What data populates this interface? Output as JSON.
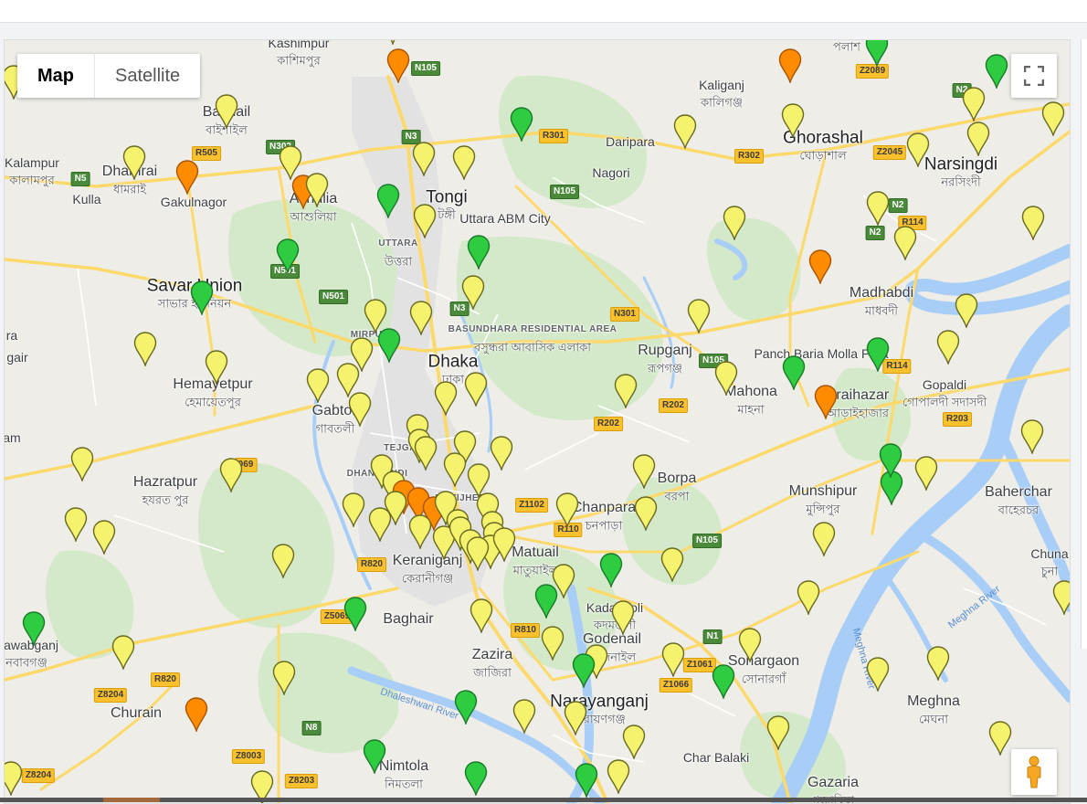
{
  "map_type": {
    "options": [
      "Map",
      "Satellite"
    ],
    "selected": "Map"
  },
  "controls": {
    "fullscreen_icon": "fullscreen-icon",
    "street_view_icon": "pegman-icon"
  },
  "marker_colors": {
    "green": "#2ecc40",
    "yellow": "#f5f26e",
    "orange": "#ff8c00"
  },
  "places": [
    {
      "id": "kashimpur",
      "en": "Kashimpur",
      "bn": "কাশিমপুর"
    },
    {
      "id": "kaliganj",
      "en": "Kaliganj",
      "bn": "কালিগঞ্জ"
    },
    {
      "id": "palash",
      "en": "",
      "bn": "পলাশ"
    },
    {
      "id": "bashail",
      "en": "Bashail",
      "bn": "বাইশাইল"
    },
    {
      "id": "kalampur",
      "en": "Kalampur",
      "bn": "কালামপুর"
    },
    {
      "id": "dhamrai",
      "en": "Dhamrai",
      "bn": "ধামরাই"
    },
    {
      "id": "kulla",
      "en": "Kulla",
      "bn": ""
    },
    {
      "id": "gakulnagor",
      "en": "Gakulnagor",
      "bn": ""
    },
    {
      "id": "ashulia",
      "en": "Ashulia",
      "bn": "আশুলিয়া"
    },
    {
      "id": "tongi",
      "en": "Tongi",
      "bn": "টঙ্গী"
    },
    {
      "id": "uttara_abm",
      "en": "Uttara ABM City",
      "bn": ""
    },
    {
      "id": "uttara",
      "en": "UTTARA",
      "bn": "উত্তরা"
    },
    {
      "id": "daripara",
      "en": "Daripara",
      "bn": ""
    },
    {
      "id": "nagori",
      "en": "Nagori",
      "bn": ""
    },
    {
      "id": "ghorashal",
      "en": "Ghorashal",
      "bn": "ঘোড়াশাল"
    },
    {
      "id": "narsingdi",
      "en": "Narsingdi",
      "bn": "নরসিংদী"
    },
    {
      "id": "savar",
      "en": "Savar Union",
      "bn": "সাভার ইউনিয়ন"
    },
    {
      "id": "mirpur",
      "en": "MIRPUR",
      "bn": ""
    },
    {
      "id": "bashundhara",
      "en": "BASUNDHARA RESIDENTIAL AREA",
      "bn": "বসুন্ধরা আবাসিক এলাকা"
    },
    {
      "id": "dhaka",
      "en": "Dhaka",
      "bn": "ঢাকা"
    },
    {
      "id": "madhabdi",
      "en": "Madhabdi",
      "bn": "মাধবদী"
    },
    {
      "id": "rupganj",
      "en": "Rupganj",
      "bn": "রূপগঞ্জ"
    },
    {
      "id": "panchbaria",
      "en": "Panch Baria Molla Para",
      "bn": ""
    },
    {
      "id": "hemayetpur",
      "en": "Hemayetpur",
      "bn": "হেমায়েতপুর"
    },
    {
      "id": "gabtoli",
      "en": "Gabtoli",
      "bn": "গাবতলী"
    },
    {
      "id": "mahona",
      "en": "Mahona",
      "bn": "মাহনা"
    },
    {
      "id": "araihazar",
      "en": "Araihazar",
      "bn": "আড়াইহাজার"
    },
    {
      "id": "gopaldi",
      "en": "Gopaldi",
      "bn": "গোপালদী সদাসদী"
    },
    {
      "id": "hazratpur",
      "en": "Hazratpur",
      "bn": "হযরত পুর"
    },
    {
      "id": "tejgaon",
      "en": "TEJGAON",
      "bn": ""
    },
    {
      "id": "dhanmondi",
      "en": "DHANMONDI",
      "bn": ""
    },
    {
      "id": "motijheel",
      "en": "MOTIJHEEL",
      "bn": ""
    },
    {
      "id": "borpa",
      "en": "Borpa",
      "bn": "বরপা"
    },
    {
      "id": "munshipur",
      "en": "Munshipur",
      "bn": "মুন্সিপুর"
    },
    {
      "id": "baherchar",
      "en": "Baherchar",
      "bn": "বাহেরচর"
    },
    {
      "id": "chanpara",
      "en": "Chanpara",
      "bn": "চনপাড়া"
    },
    {
      "id": "keraniganj",
      "en": "Keraniganj",
      "bn": "কেরানীগঞ্জ"
    },
    {
      "id": "matuail",
      "en": "Matuail",
      "bn": "মাতুয়াইল"
    },
    {
      "id": "chuna",
      "en": "Chuna",
      "bn": "চুনা"
    },
    {
      "id": "kadamtoli",
      "en": "Kadamtoli",
      "bn": "কদমতলী"
    },
    {
      "id": "baghair",
      "en": "Baghair",
      "bn": ""
    },
    {
      "id": "godenail",
      "en": "Godenail",
      "bn": "গোদনাইল"
    },
    {
      "id": "nawabganj",
      "en": "Nawabganj",
      "bn": "নবাবগঞ্জ"
    },
    {
      "id": "zazira",
      "en": "Zazira",
      "bn": "জাজিরা"
    },
    {
      "id": "sonargaon",
      "en": "Sonargaon",
      "bn": "সোনারগাঁ"
    },
    {
      "id": "narayanganj",
      "en": "Narayanganj",
      "bn": "নারায়ণগঞ্জ"
    },
    {
      "id": "meghna",
      "en": "Meghna",
      "bn": "মেঘনা"
    },
    {
      "id": "churain",
      "en": "Churain",
      "bn": ""
    },
    {
      "id": "nimtola",
      "en": "Nimtola",
      "bn": "নিমতলা"
    },
    {
      "id": "charbalaki",
      "en": "Char Balaki",
      "bn": ""
    },
    {
      "id": "gazaria",
      "en": "Gazaria",
      "bn": "গজারিয়া"
    },
    {
      "id": "ra",
      "en": "ra",
      "bn": ""
    },
    {
      "id": "gair",
      "en": "gair",
      "bn": ""
    },
    {
      "id": "am",
      "en": "am",
      "bn": ""
    }
  ],
  "rivers": [
    "Dhaleshwari River",
    "Meghna River",
    "Meghna River"
  ],
  "road_shields": [
    {
      "label": "N105",
      "style": "g"
    },
    {
      "label": "R505",
      "style": "y"
    },
    {
      "label": "N302",
      "style": "g"
    },
    {
      "label": "N5",
      "style": "g"
    },
    {
      "label": "N3",
      "style": "g"
    },
    {
      "label": "R301",
      "style": "y"
    },
    {
      "label": "N105",
      "style": "g"
    },
    {
      "label": "R302",
      "style": "y"
    },
    {
      "label": "Z2045",
      "style": "y"
    },
    {
      "label": "N2",
      "style": "g"
    },
    {
      "label": "N2",
      "style": "g"
    },
    {
      "label": "R114",
      "style": "y"
    },
    {
      "label": "N2",
      "style": "g"
    },
    {
      "label": "Z2089",
      "style": "y"
    },
    {
      "label": "N501",
      "style": "g"
    },
    {
      "label": "N501",
      "style": "g"
    },
    {
      "label": "N3",
      "style": "g"
    },
    {
      "label": "N301",
      "style": "y"
    },
    {
      "label": "N105",
      "style": "g"
    },
    {
      "label": "R114",
      "style": "y"
    },
    {
      "label": "R202",
      "style": "y"
    },
    {
      "label": "R202",
      "style": "y"
    },
    {
      "label": "R203",
      "style": "y"
    },
    {
      "label": "069",
      "style": "y"
    },
    {
      "label": "Z1102",
      "style": "y"
    },
    {
      "label": "R110",
      "style": "y"
    },
    {
      "label": "N105",
      "style": "g"
    },
    {
      "label": "R820",
      "style": "y"
    },
    {
      "label": "Z5069",
      "style": "y"
    },
    {
      "label": "R810",
      "style": "y"
    },
    {
      "label": "N1",
      "style": "g"
    },
    {
      "label": "Z1061",
      "style": "y"
    },
    {
      "label": "Z1066",
      "style": "y"
    },
    {
      "label": "R820",
      "style": "y"
    },
    {
      "label": "Z8204",
      "style": "y"
    },
    {
      "label": "N8",
      "style": "g"
    },
    {
      "label": "Z8003",
      "style": "y"
    },
    {
      "label": "Z8203",
      "style": "y"
    },
    {
      "label": "Z8204",
      "style": "y"
    }
  ],
  "markers": [
    {
      "color": "yellow"
    },
    {
      "color": "orange"
    },
    {
      "color": "yellow"
    },
    {
      "color": "orange"
    },
    {
      "color": "green"
    },
    {
      "color": "green"
    },
    {
      "color": "yellow"
    },
    {
      "color": "yellow"
    },
    {
      "color": "yellow"
    },
    {
      "color": "orange"
    },
    {
      "color": "yellow"
    },
    {
      "color": "yellow"
    },
    {
      "color": "yellow"
    },
    {
      "color": "yellow"
    },
    {
      "color": "green"
    },
    {
      "color": "yellow"
    },
    {
      "color": "yellow"
    },
    {
      "color": "yellow"
    },
    {
      "color": "yellow"
    },
    {
      "color": "orange"
    },
    {
      "color": "yellow"
    },
    {
      "color": "green"
    },
    {
      "color": "yellow"
    },
    {
      "color": "yellow"
    },
    {
      "color": "yellow"
    },
    {
      "color": "yellow"
    },
    {
      "color": "green"
    },
    {
      "color": "green"
    },
    {
      "color": "yellow"
    },
    {
      "color": "orange"
    },
    {
      "color": "green"
    },
    {
      "color": "yellow"
    },
    {
      "color": "yellow"
    },
    {
      "color": "yellow"
    },
    {
      "color": "yellow"
    },
    {
      "color": "yellow"
    },
    {
      "color": "yellow"
    },
    {
      "color": "yellow"
    },
    {
      "color": "green"
    },
    {
      "color": "yellow"
    },
    {
      "color": "green"
    },
    {
      "color": "green"
    },
    {
      "color": "yellow"
    },
    {
      "color": "yellow"
    },
    {
      "color": "yellow"
    },
    {
      "color": "yellow"
    },
    {
      "color": "yellow"
    },
    {
      "color": "yellow"
    },
    {
      "color": "yellow"
    },
    {
      "color": "yellow"
    },
    {
      "color": "orange"
    },
    {
      "color": "yellow"
    },
    {
      "color": "yellow"
    },
    {
      "color": "yellow"
    },
    {
      "color": "yellow"
    },
    {
      "color": "yellow"
    },
    {
      "color": "yellow"
    },
    {
      "color": "yellow"
    },
    {
      "color": "yellow"
    },
    {
      "color": "yellow"
    },
    {
      "color": "yellow"
    },
    {
      "color": "yellow"
    },
    {
      "color": "orange"
    },
    {
      "color": "orange"
    },
    {
      "color": "orange"
    },
    {
      "color": "yellow"
    },
    {
      "color": "yellow"
    },
    {
      "color": "yellow"
    },
    {
      "color": "yellow"
    },
    {
      "color": "yellow"
    },
    {
      "color": "yellow"
    },
    {
      "color": "yellow"
    },
    {
      "color": "yellow"
    },
    {
      "color": "yellow"
    },
    {
      "color": "yellow"
    },
    {
      "color": "green"
    },
    {
      "color": "green"
    },
    {
      "color": "yellow"
    },
    {
      "color": "yellow"
    },
    {
      "color": "yellow"
    },
    {
      "color": "yellow"
    },
    {
      "color": "yellow"
    },
    {
      "color": "yellow"
    },
    {
      "color": "yellow"
    },
    {
      "color": "yellow"
    },
    {
      "color": "yellow"
    },
    {
      "color": "yellow"
    },
    {
      "color": "yellow"
    },
    {
      "color": "yellow"
    },
    {
      "color": "yellow"
    },
    {
      "color": "green"
    },
    {
      "color": "yellow"
    },
    {
      "color": "yellow"
    },
    {
      "color": "yellow"
    },
    {
      "color": "yellow"
    },
    {
      "color": "green"
    },
    {
      "color": "yellow"
    },
    {
      "color": "green"
    },
    {
      "color": "yellow"
    },
    {
      "color": "yellow"
    },
    {
      "color": "yellow"
    },
    {
      "color": "yellow"
    },
    {
      "color": "green"
    },
    {
      "color": "yellow"
    },
    {
      "color": "yellow"
    },
    {
      "color": "green"
    },
    {
      "color": "yellow"
    },
    {
      "color": "yellow"
    },
    {
      "color": "green"
    },
    {
      "color": "yellow"
    },
    {
      "color": "yellow"
    },
    {
      "color": "orange"
    },
    {
      "color": "green"
    },
    {
      "color": "yellow"
    },
    {
      "color": "yellow"
    },
    {
      "color": "green"
    },
    {
      "color": "yellow"
    },
    {
      "color": "yellow"
    },
    {
      "color": "yellow"
    },
    {
      "color": "yellow"
    },
    {
      "color": "green"
    },
    {
      "color": "yellow"
    },
    {
      "color": "green"
    },
    {
      "color": "yellow"
    }
  ]
}
